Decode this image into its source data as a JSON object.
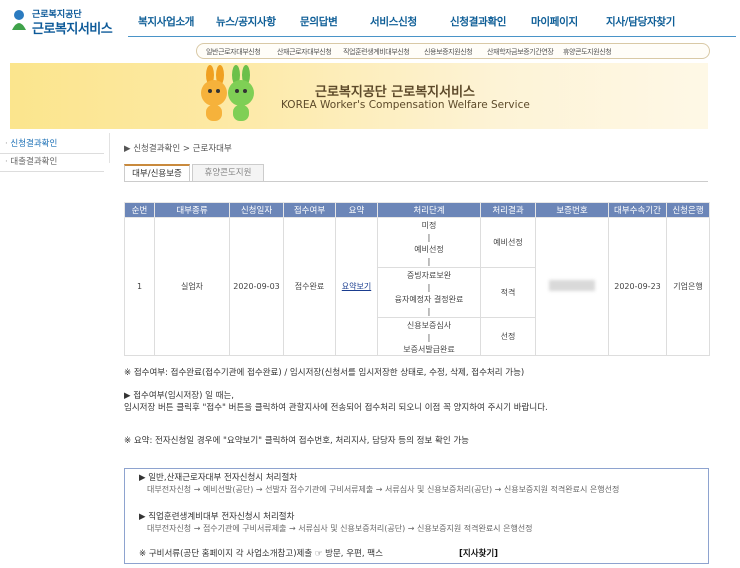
{
  "logo": {
    "line1": "근로복지공단",
    "line2": "근로복지서비스"
  },
  "gnb": [
    "복지사업소개",
    "뉴스/공지사항",
    "문의답변",
    "서비스신청",
    "신청결과확인",
    "마이페이지",
    "지사/담당자찾기"
  ],
  "subnav": [
    "일반근로자대부신청",
    "산재근로자대부신청",
    "직업훈련생계비대부신청",
    "신용보증지원신청",
    "산재학자금보증기간연장",
    "휴양콘도지원신청"
  ],
  "banner": {
    "title": "근로복지공단 근로복지서비스",
    "subtitle": "KOREA Worker's Compensation Welfare Service"
  },
  "lnb": [
    "신청결과확인",
    "대출결과확인"
  ],
  "breadcrumb": "▶ 신청결과확인 > 근로자대부",
  "tabs": [
    "대부/신용보증",
    "휴양콘도지원"
  ],
  "table": {
    "headers": [
      "순번",
      "대부종류",
      "신청일자",
      "접수여부",
      "요약",
      "처리단계",
      "처리결과",
      "보증번호",
      "대부수속기간",
      "신청은행"
    ],
    "row": {
      "no": "1",
      "type": "실업자",
      "date": "2020-09-03",
      "status": "접수완료",
      "summary": "요약보기",
      "stages": [
        [
          "미정",
          "|",
          "예비선정",
          "|"
        ],
        [
          "증빙자료보완",
          "|",
          "융자예정자 결정완료",
          "|"
        ],
        [
          "신용보증심사",
          "|",
          "보증서발급완료"
        ]
      ],
      "results": [
        "예비선정",
        "적격",
        "선정"
      ],
      "period": "2020-09-23",
      "bank": "기업은행"
    }
  },
  "notes": {
    "n1": "※ 접수여부: 접수완료(접수기관에 접수완료) / 임시저장(신청서를 임시저장한 상태로, 수정, 삭제, 접수처리 가능)",
    "n2": "▶ 접수여부(임시저장) 일 때는,",
    "n3": "임시저장 버튼 클릭후 \"접수\" 버튼을 클릭하여 관할지사에 전송되어 접수처리 되오니 이점 꼭 양지하여 주시기 바랍니다.",
    "n4": "※ 요약: 전자신청일 경우에 \"요약보기\" 클릭하여 접수번호, 처리지사, 담당자 등의 정보 확인 가능"
  },
  "info": {
    "h1": "▶ 일반,산재근로자대부 전자신청시 처리절차",
    "b1": "대부전자신청 → 예비선발(공단) → 선발자 접수기관에 구비서류제출 → 서류심사 및 신용보증처리(공단) → 신용보증지원 적격완료시 은행선정",
    "h2": "▶ 직업훈련생계비대부 전자신청시 처리절차",
    "b2": "대부전자신청 → 접수기관에 구비서류제출 → 서류심사 및 신용보증처리(공단) → 신용보증지원 적격완료시 은행선정",
    "docs": "※ 구비서류(공단 홈페이지 각 사업소개참고)제출 ☞ 방문, 우편, 팩스",
    "find": "[지사찾기]"
  },
  "colors": {
    "header_blue": "#0d5a99",
    "table_header": "#6c86b8",
    "accent": "#c98a3d"
  }
}
